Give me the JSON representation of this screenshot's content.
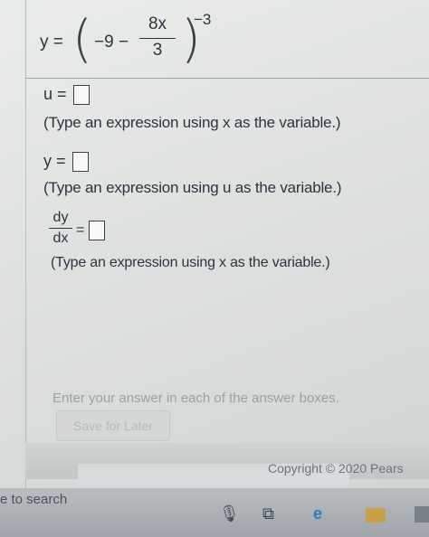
{
  "formula": {
    "lhs": "y =",
    "inner": "−9 −",
    "numerator": "8x",
    "denominator": "3",
    "exponent": "−3",
    "paren_left": "(",
    "paren_right": ")"
  },
  "questions": [
    {
      "label": "u =",
      "hint": "(Type an expression using x as the variable.)"
    },
    {
      "label": "y =",
      "hint": "(Type an expression using u as the variable.)"
    },
    {
      "label_num": "dy",
      "label_den": "dx",
      "equals": "=",
      "hint": "(Type an expression using x as the variable.)"
    }
  ],
  "footer": {
    "instruction": "Enter your answer in each of the answer boxes.",
    "save_label": "Save for Later",
    "copyright": "Copyright © 2020 Pears"
  },
  "taskbar": {
    "search_text": "e to search",
    "icons": [
      "microphone-icon",
      "task-view-icon",
      "edge-browser-icon",
      "file-explorer-icon",
      "store-icon"
    ]
  }
}
